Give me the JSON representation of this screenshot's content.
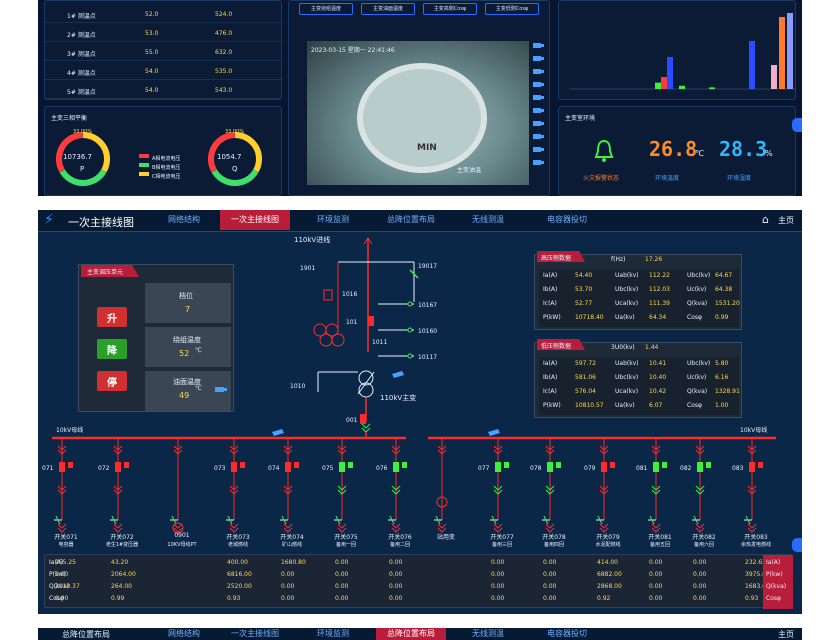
{
  "top_panel": {
    "table_rows": [
      {
        "name": "1# 测温点",
        "v1": "52.0",
        "v2": "524.0"
      },
      {
        "name": "2# 测温点",
        "v1": "53.0",
        "v2": "476.0"
      },
      {
        "name": "3# 测温点",
        "v1": "55.0",
        "v2": "632.0"
      },
      {
        "name": "4# 测温点",
        "v1": "54.0",
        "v2": "535.0"
      },
      {
        "name": "5# 测温点",
        "v1": "54.0",
        "v2": "543.0"
      }
    ],
    "video_tabs": [
      "主变绕组温度",
      "主变油面温度",
      "主变高侧Cosφ",
      "主变低侧Cosφ"
    ],
    "video_timestamp": "2023-03-15 星期一 22:41:46",
    "video_caption": "主变油温",
    "gauge_min_label": "MIN",
    "balance_title": "主变三相平衡",
    "gauge_p": {
      "value": "10736.7",
      "label": "P",
      "pct_label": "33.00%"
    },
    "gauge_q": {
      "value": "1054.7",
      "label": "Q",
      "pct_label": "33.00%"
    },
    "legend": [
      "A相电流电压",
      "B相电流电压",
      "C相电流电压"
    ],
    "env_title": "主变室环境",
    "alarm_label": "火灾报警状态",
    "temp_value": "26.8",
    "temp_unit": "℃",
    "humid_value": "28.3",
    "humid_unit": "%",
    "temp_label": "环境温度",
    "humid_label": "环境湿度"
  },
  "header": {
    "title": "一次主接线图",
    "home_label": "主页",
    "tabs": [
      "网络结构",
      "一次主接线图",
      "环境监测",
      "总降位置布局",
      "无线测温",
      "电容器投切"
    ]
  },
  "transformer_unit": {
    "title": "主变调压单元",
    "btn_up": "升",
    "btn_down": "降",
    "btn_stop": "停",
    "gear_label": "档位",
    "gear_value": "7",
    "winding_label": "绕组温度",
    "winding_value": "52",
    "oil_label": "油面温度",
    "oil_value": "49",
    "unit_c": "℃"
  },
  "diagram": {
    "bus_110": "110kV进线",
    "sw_1901": "1901",
    "sw_19017": "19017",
    "sw_1016": "1016",
    "sw_101": "101",
    "sw_10167": "10167",
    "sw_10160": "10160",
    "sw_1011": "1011",
    "sw_10117": "10117",
    "sw_1010": "1010",
    "main_transformer": "110kV主变",
    "sw_001": "001",
    "bus_10_left": "10kV母线",
    "bus_10_right": "10kV母线",
    "feeders": [
      {
        "id": "071",
        "name": "开关071",
        "sub": "电容器",
        "color": "#ff2a2a"
      },
      {
        "id": "072",
        "name": "开关072",
        "sub": "老生1#变压器",
        "color": "#ff2a2a"
      },
      {
        "id": "",
        "name": "0901",
        "sub": "10KV母线PT",
        "color": ""
      },
      {
        "id": "073",
        "name": "开关073",
        "sub": "老城燃线",
        "color": "#ff2a2a"
      },
      {
        "id": "074",
        "name": "开关074",
        "sub": "矿山燃线",
        "color": "#ff2a2a"
      },
      {
        "id": "075",
        "name": "开关075",
        "sub": "备用一回",
        "color": "#3cf03c"
      },
      {
        "id": "076",
        "name": "开关076",
        "sub": "备用二回",
        "color": "#3cf03c"
      },
      {
        "id": "",
        "name": "站用变",
        "sub": "",
        "color": ""
      },
      {
        "id": "077",
        "name": "开关077",
        "sub": "备用三回",
        "color": "#3cf03c"
      },
      {
        "id": "078",
        "name": "开关078",
        "sub": "备用四回",
        "color": "#3cf03c"
      },
      {
        "id": "079",
        "name": "开关079",
        "sub": "水泥配燃线",
        "color": "#ff2a2a"
      },
      {
        "id": "081",
        "name": "开关081",
        "sub": "备用五回",
        "color": "#3cf03c"
      },
      {
        "id": "082",
        "name": "开关082",
        "sub": "备用六回",
        "color": "#3cf03c"
      },
      {
        "id": "083",
        "name": "开关083",
        "sub": "余热发电燃线",
        "color": "#ff2a2a"
      }
    ]
  },
  "hv_data": {
    "title": "高压侧数据",
    "fhz_label": "f(Hz)",
    "fhz_value": "17.26",
    "rows": [
      [
        "Ia(A)",
        "54.40",
        "Uab(kv)",
        "112.22",
        "Ubc(kv)",
        "64.67"
      ],
      [
        "Ib(A)",
        "53.70",
        "Ubc(kv)",
        "112.03",
        "Uc(kv)",
        "64.38"
      ],
      [
        "Ic(A)",
        "52.77",
        "Uca(kv)",
        "111.39",
        "Q(kva)",
        "1531.20"
      ],
      [
        "P(kW)",
        "10718.40",
        "Ua(kv)",
        "64.34",
        "Cosφ",
        "0.99"
      ]
    ]
  },
  "lv_data": {
    "title": "低压侧数据",
    "fhz_label": "3U0(kv)",
    "fhz_value": "1.44",
    "rows": [
      [
        "Ia(A)",
        "597.72",
        "Uab(kv)",
        "10.41",
        "Ubc(kv)",
        "5.80"
      ],
      [
        "Ib(A)",
        "581.06",
        "Ubc(kv)",
        "10.40",
        "Uc(kv)",
        "6.16"
      ],
      [
        "Ic(A)",
        "576.04",
        "Uca(kv)",
        "10.42",
        "Q(kva)",
        "1328.91"
      ],
      [
        "P(kW)",
        "10810.57",
        "Ua(kv)",
        "6.07",
        "Cosφ",
        "1.00"
      ]
    ]
  },
  "bottom_table": {
    "row_labels": [
      "Ia(A)",
      "P(kw)",
      "Q(kva)",
      "Cosφ"
    ],
    "cols": [
      [
        "155.25",
        "0.00",
        "2010.37",
        "0.00"
      ],
      [
        "43.20",
        "2064.00",
        "264.00",
        "0.99"
      ],
      [
        "",
        "",
        "",
        ""
      ],
      [
        "400.00",
        "6816.00",
        "2520.00",
        "0.93"
      ],
      [
        "1680.80",
        "0.00",
        "0.00",
        "0.00"
      ],
      [
        "0.00",
        "0.00",
        "0.00",
        "0.00"
      ],
      [
        "0.00",
        "0.00",
        "0.00",
        "0.00"
      ],
      [
        "",
        "",
        "",
        ""
      ],
      [
        "0.00",
        "0.00",
        "0.00",
        "0.00"
      ],
      [
        "0.00",
        "0.00",
        "0.00",
        "0.00"
      ],
      [
        "414.00",
        "6882.00",
        "2868.00",
        "0.92"
      ],
      [
        "0.00",
        "0.00",
        "0.00",
        "0.00"
      ],
      [
        "0.00",
        "0.00",
        "0.00",
        "0.00"
      ],
      [
        "232.62",
        "3975.04",
        "1683.69",
        "0.93"
      ]
    ]
  },
  "bottom_header": {
    "title": "总降位置布局",
    "tabs": [
      "网络结构",
      "一次主接线图",
      "环境监测",
      "总降位置布局",
      "无线测温",
      "电容器投切"
    ],
    "home_label": "主页"
  }
}
